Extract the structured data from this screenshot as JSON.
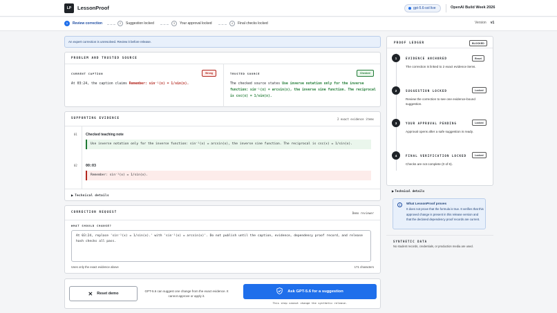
{
  "app": {
    "logo": "LP",
    "name": "LessonProof",
    "model_pill": "gpt-5.6-sol live",
    "build_week": "OpenAI Build Week 2026"
  },
  "steps": [
    {
      "num": "1",
      "label": "Review correction"
    },
    {
      "num": "2",
      "label": "Suggestion locked"
    },
    {
      "num": "3",
      "label": "Your approval locked"
    },
    {
      "num": "4",
      "label": "Final checks locked"
    }
  ],
  "version": {
    "label": "Version",
    "value": "v1"
  },
  "alert": "An expert correction is unresolved. Review it before release.",
  "problem": {
    "title": "PROBLEM AND TRUSTED SOURCE",
    "current_label": "CURRENT CAPTION",
    "current_badge": "Wrong",
    "current_prefix": "At 03:24, the caption claims",
    "current_claim": "Remember: sin⁻¹(x) = 1/sin(x).",
    "trusted_label": "TRUSTED SOURCE",
    "trusted_badge": "Checked",
    "trusted_prefix": "The checked source states",
    "trusted_claim": "Use inverse notation only for the inverse function: sin⁻¹(x) = arcsin(x), the inverse sine function. The reciprocal is csc(x) = 1/sin(x)."
  },
  "evidence": {
    "title": "SUPPORTING EVIDENCE",
    "count": "2 exact evidence items",
    "items": [
      {
        "num": "01",
        "title": "Checked teaching note",
        "quote": "Use inverse notation only for the inverse function: sin⁻¹(x) = arcsin(x), the inverse sine function. The reciprocal is csc(x) = 1/sin(x)."
      },
      {
        "num": "02",
        "title": "00:03",
        "quote": "Remember: sin⁻¹(x) = 1/sin(x)."
      }
    ],
    "technical": "Technical details"
  },
  "correction": {
    "title": "CORRECTION REQUEST",
    "demo": "Demo reviewer",
    "question": "WHAT SHOULD CHANGE?",
    "text": "At 03:24, replace 'sin⁻¹(x) = 1/sin(x).' with 'sin⁻¹(x) = arcsin(x)'. Do not publish until the caption, evidence, dependency proof record, and release hash checks all pass.",
    "footer_left": "Uses only the exact evidence above",
    "footer_right": "171 characters"
  },
  "actions": {
    "reset": "Reset demo",
    "note": "GPT-5.6 can suggest one change from the exact evidence. It cannot approve or apply it.",
    "ask": "Ask GPT-5.6 for a suggestion",
    "ask_sub": "This step cannot change the synthetic release."
  },
  "ledger": {
    "title": "PROOF LEDGER",
    "status": "BLOCKED",
    "items": [
      {
        "num": "1",
        "title": "EVIDENCE ANCHORED",
        "badge": "Reset",
        "desc": "The correction is linked to 2 exact evidence items."
      },
      {
        "num": "2",
        "title": "SUGGESTION LOCKED",
        "badge": "Locked",
        "desc": "Review the correction to see one evidence-bound suggestion."
      },
      {
        "num": "3",
        "title": "YOUR APPROVAL PENDING",
        "badge": "Locked",
        "desc": "Approval opens after a safe suggestion is ready."
      },
      {
        "num": "4",
        "title": "FINAL VERIFICATION LOCKED",
        "badge": "Locked",
        "desc": "Checks are not complete (0 of 6)."
      }
    ],
    "technical": "Technical details"
  },
  "proves": {
    "title": "What LessonProof proves",
    "text": "It does not prove that the formula is true. It verifies that this approved change is present in this release version and that the declared dependency proof records are current."
  },
  "synthetic": {
    "title": "SYNTHETIC DATA",
    "text": "No student records, credentials, or production media are used."
  }
}
